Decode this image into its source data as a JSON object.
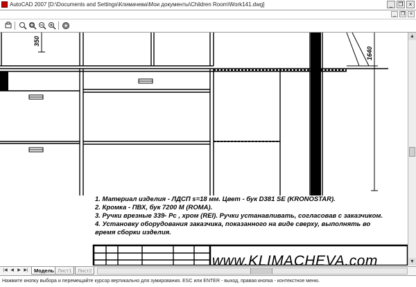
{
  "window": {
    "app_name": "AutoCAD 2007",
    "title": "[D:\\Documents and Settings\\Климачева\\Мои документы\\Children Room\\Work141.dwg]",
    "minimize_glyph": "_",
    "restore_glyph": "❐",
    "close_glyph": "×"
  },
  "icons": {
    "app": "autocad-icon",
    "toolbar": [
      "pan-icon",
      "zoom-realtime-icon",
      "zoom-window-icon",
      "zoom-previous-icon",
      "zoom-extents-icon",
      "plot-icon"
    ]
  },
  "drawing": {
    "dimension_left": "350",
    "dimension_right": "1640",
    "notes": [
      "1.  Материал изделия - ЛДСП  s=18  мм. Цвет - бук  D381  SE (KRONOSTAR).",
      "2.  Кромка - ПВХ, бук  7200 М  (ROMA).",
      "3. Ручки врезные  339- Pc , хром  (REI).  Ручки устанавливать, согласовав с заказчиком.",
      "4. Установку оборудования заказчика, показанного на виде сверху, выполнять  во",
      "время сборки  изделия."
    ],
    "website": "www.KLIMACHEVA.com"
  },
  "tabs": [
    "Модель",
    "Лист1",
    "Лист2"
  ],
  "status": {
    "text": "Нажмите кнопку выбора и перемещайте курсор вертикально для зумирования. ESC или ENTER - выход, правая кнопка - контекстное меню."
  },
  "colors": {
    "accent": "#c40000",
    "chrome": "#9a9a9a"
  }
}
